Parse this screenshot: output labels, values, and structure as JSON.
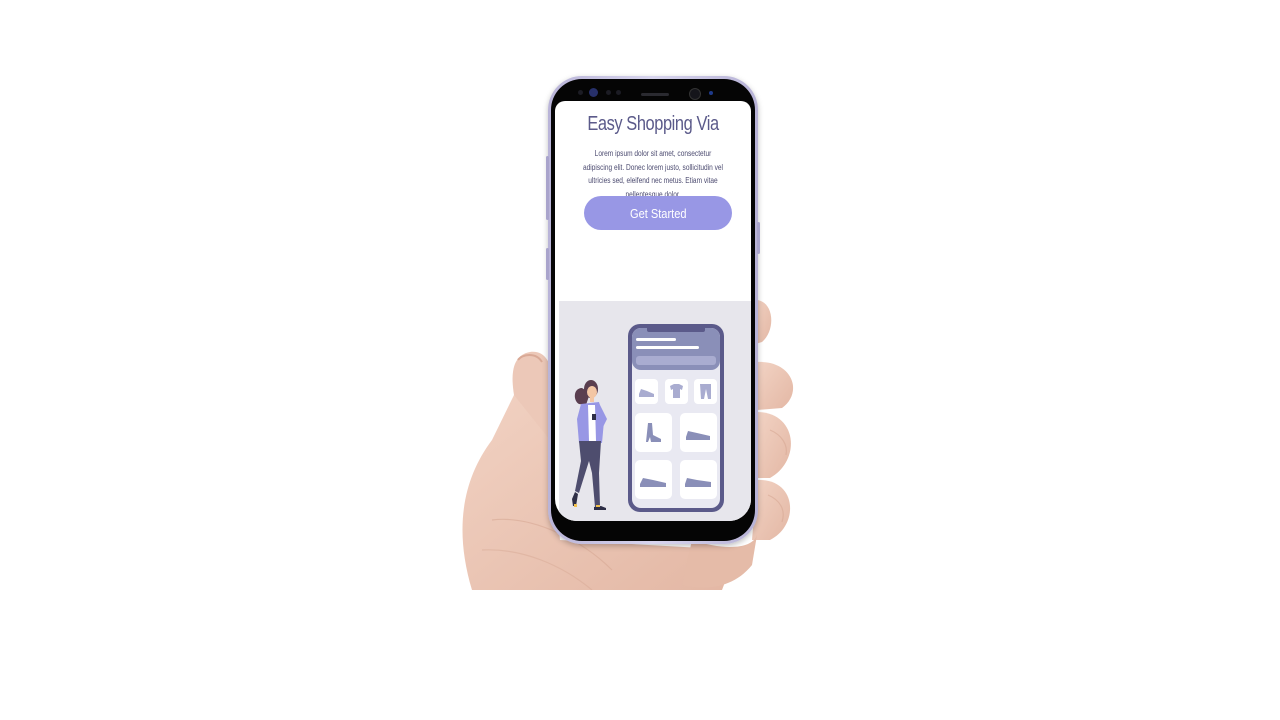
{
  "screen": {
    "title": "Easy Shopping Via",
    "description": "Lorem ipsum dolor sit amet, consectetur adipiscing elit. Donec lorem justo, sollicitudin vel ultricies sed, eleifend nec metus. Etiam vitae pellentesque dolor.",
    "cta_label": "Get Started"
  },
  "colors": {
    "accent": "#9897e5",
    "title": "#5b5a8a",
    "illustration_bg": "#e7e6ec",
    "phone_frame": "#c6c2e4"
  },
  "illustration": {
    "figure": "woman-holding-phone",
    "device": "shopping-app-mockup",
    "product_icons": [
      "shoe-icon",
      "tshirt-icon",
      "pants-icon",
      "boot-icon",
      "sneaker-icon",
      "sneaker-icon",
      "sneaker-icon"
    ]
  }
}
